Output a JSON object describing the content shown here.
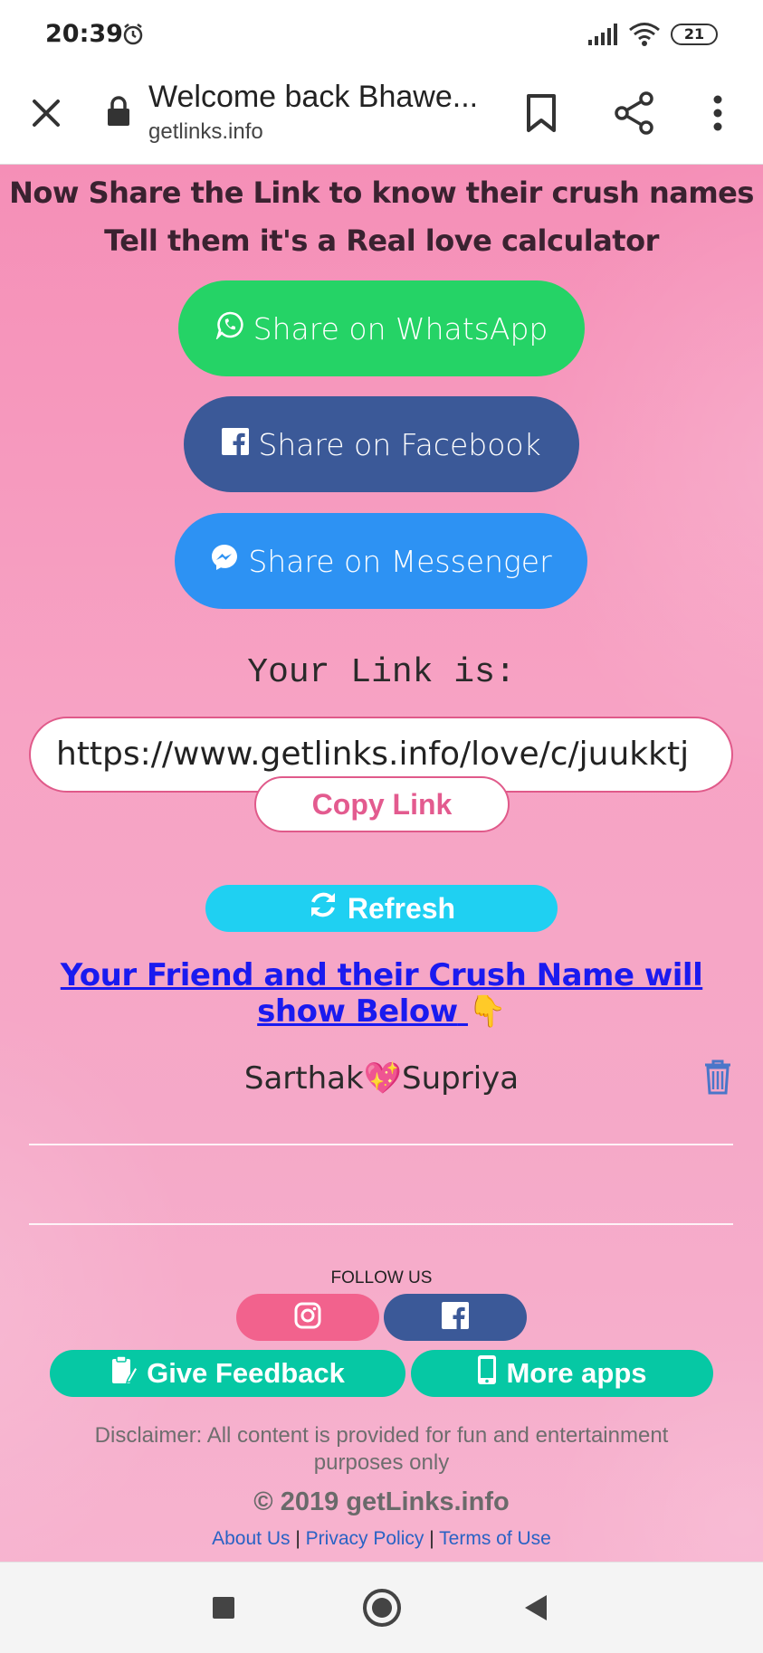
{
  "status_bar": {
    "time": "20:39",
    "battery": "21"
  },
  "browser": {
    "title": "Welcome back Bhawe...",
    "url": "getlinks.info"
  },
  "page": {
    "heading_line1": "Now Share the Link to know their crush names",
    "heading_line2": "Tell them it's a Real love calculator",
    "share_whatsapp": "Share on WhatsApp",
    "share_facebook": "Share on Facebook",
    "share_messenger": "Share on Messenger",
    "your_link_label": "Your Link is:",
    "link_value": "https://www.getlinks.info/love/c/juukktj",
    "copy_link": "Copy Link",
    "refresh": "Refresh",
    "crush_heading": "Your Friend and their Crush Name will show Below",
    "crush_entry": {
      "friend": "Sarthak",
      "crush": "Supriya"
    },
    "follow_us": "FOLLOW US",
    "give_feedback": "Give Feedback",
    "more_apps": "More apps",
    "disclaimer": "Disclaimer: All content is provided for fun and entertainment purposes only",
    "copyright": "© 2019 getLinks.info",
    "footer_links": {
      "about": "About Us",
      "privacy": "Privacy Policy",
      "terms": "Terms of Use",
      "separator": "|"
    }
  },
  "colors": {
    "whatsapp": "#25d366",
    "facebook": "#3b5998",
    "messenger": "#2d92f3",
    "refresh": "#1fd0f2",
    "feedback": "#06c8a4",
    "instagram": "#f2628d",
    "crush_heading": "#1a1aef",
    "copy_link": "#e35b8f"
  },
  "icons": {
    "close": "close-icon",
    "lock": "lock-icon",
    "bookmark": "bookmark-icon",
    "share": "share-icon",
    "more": "more-vert-icon",
    "whatsapp": "whatsapp-icon",
    "facebook": "facebook-icon",
    "messenger": "messenger-icon",
    "refresh": "refresh-icon",
    "trash": "trash-icon",
    "instagram": "instagram-icon",
    "feedback": "clipboard-icon",
    "mobile": "mobile-icon"
  }
}
